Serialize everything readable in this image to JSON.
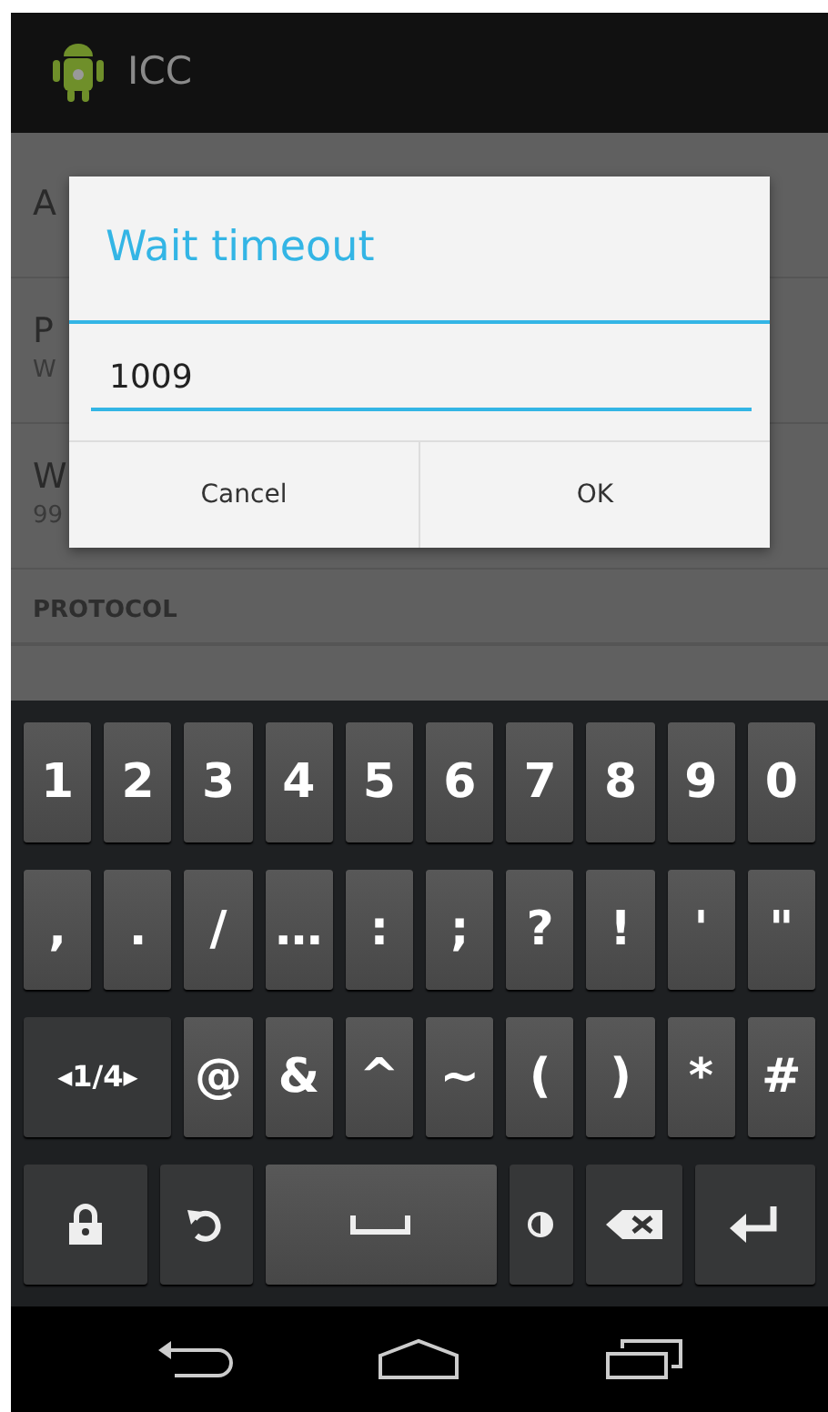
{
  "action_bar": {
    "title": "ICC"
  },
  "list": {
    "items": [
      {
        "kind": "item",
        "title": "A"
      },
      {
        "kind": "item",
        "title": "P",
        "subtitle": "W"
      },
      {
        "kind": "item",
        "title": "W",
        "subtitle": "99"
      },
      {
        "kind": "header",
        "title": "PROTOCOL"
      }
    ]
  },
  "dialog": {
    "title": "Wait timeout",
    "value": "1009",
    "buttons": [
      "Cancel",
      "OK"
    ]
  },
  "keyboard": {
    "rows": [
      {
        "keys": [
          {
            "kind": "char",
            "label": "1"
          },
          {
            "kind": "char",
            "label": "2"
          },
          {
            "kind": "char",
            "label": "3"
          },
          {
            "kind": "char",
            "label": "4"
          },
          {
            "kind": "char",
            "label": "5"
          },
          {
            "kind": "char",
            "label": "6"
          },
          {
            "kind": "char",
            "label": "7"
          },
          {
            "kind": "char",
            "label": "8"
          },
          {
            "kind": "char",
            "label": "9"
          },
          {
            "kind": "char",
            "label": "0"
          }
        ]
      },
      {
        "keys": [
          {
            "kind": "char",
            "label": ","
          },
          {
            "kind": "char",
            "label": "."
          },
          {
            "kind": "char",
            "label": "/"
          },
          {
            "kind": "char",
            "label": "…"
          },
          {
            "kind": "char",
            "label": ":"
          },
          {
            "kind": "char",
            "label": ";"
          },
          {
            "kind": "char",
            "label": "?"
          },
          {
            "kind": "char",
            "label": "!"
          },
          {
            "kind": "char",
            "label": "'"
          },
          {
            "kind": "char",
            "label": "\""
          }
        ]
      },
      {
        "keys": [
          {
            "kind": "mode",
            "label": "◂1/4▸"
          },
          {
            "kind": "char",
            "label": "@"
          },
          {
            "kind": "char",
            "label": "&"
          },
          {
            "kind": "char",
            "label": "^"
          },
          {
            "kind": "char",
            "label": "~"
          },
          {
            "kind": "char",
            "label": "("
          },
          {
            "kind": "char",
            "label": ")"
          },
          {
            "kind": "char",
            "label": "*"
          },
          {
            "kind": "char",
            "label": "#"
          }
        ]
      },
      {
        "keys": [
          {
            "kind": "lock"
          },
          {
            "kind": "undo"
          },
          {
            "kind": "space"
          },
          {
            "kind": "contrast"
          },
          {
            "kind": "backspace"
          },
          {
            "kind": "enter"
          }
        ]
      }
    ]
  },
  "nav_bar": {
    "buttons": [
      {
        "kind": "back"
      },
      {
        "kind": "home"
      },
      {
        "kind": "recents"
      }
    ]
  }
}
